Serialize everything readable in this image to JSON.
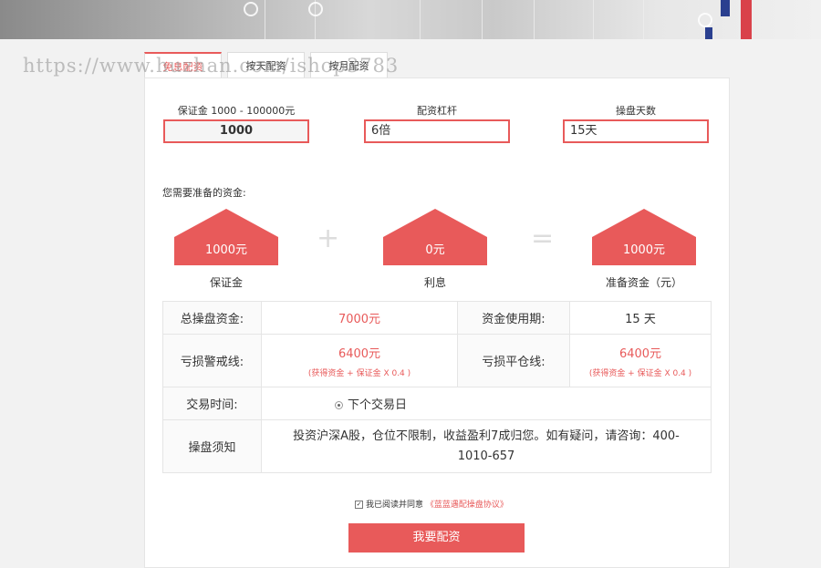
{
  "watermark": "https://www.huzhan.com/ishop3783",
  "tabs": [
    {
      "label": "免息配资",
      "active": true
    },
    {
      "label": "按天配资",
      "active": false
    },
    {
      "label": "按月配资",
      "active": false
    }
  ],
  "form": {
    "deposit": {
      "label": "保证金 1000 - 100000元",
      "value": "1000"
    },
    "leverage": {
      "label": "配资杠杆",
      "value": "6倍"
    },
    "days": {
      "label": "操盘天数",
      "value": "15天"
    }
  },
  "funds": {
    "title": "您需要准备的资金:",
    "items": [
      {
        "value": "1000元",
        "label": "保证金"
      },
      {
        "value": "0元",
        "label": "利息"
      },
      {
        "value": "1000元",
        "label": "准备资金（元）"
      }
    ],
    "plus": "+",
    "equals": "="
  },
  "table": {
    "total_label": "总操盘资金:",
    "total_value": "7000元",
    "period_label": "资金使用期:",
    "period_value": "15 天",
    "warn_label": "亏损警戒线:",
    "warn_value": "6400元",
    "warn_note": "(获得资金 + 保证金 X 0.4 )",
    "close_label": "亏损平仓线:",
    "close_value": "6400元",
    "close_note": "(获得资金 + 保证金 X 0.4 )",
    "time_label": "交易时间:",
    "time_value": "下个交易日",
    "notice_label": "操盘须知",
    "notice_value": "投资沪深A股，仓位不限制，收益盈利7成归您。如有疑问，请咨询：400-1010-657"
  },
  "agreement": {
    "prefix": "我已阅读并同意",
    "link": "《蓝蓝遇配操盘协议》"
  },
  "submit_label": "我要配资",
  "colors": {
    "accent": "#e85a5a"
  }
}
